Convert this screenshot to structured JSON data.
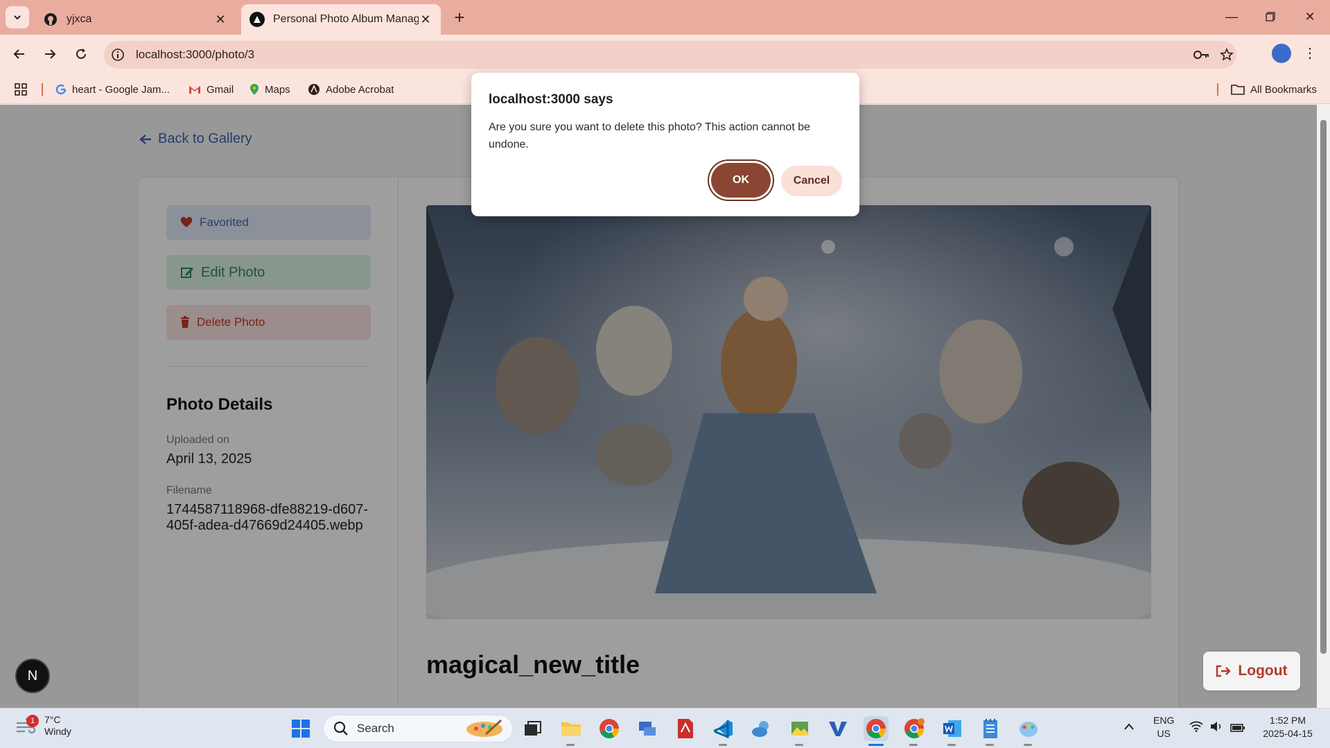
{
  "browser": {
    "tabs": [
      {
        "title": "yjxca",
        "icon": "github-icon",
        "active": false
      },
      {
        "title": "Personal Photo Album Manager",
        "icon": "nextjs-icon",
        "active": true
      }
    ],
    "url": "localhost:3000/photo/3",
    "bookmarks": [
      {
        "label": "heart - Google Jam...",
        "icon": "google-icon"
      },
      {
        "label": "Gmail",
        "icon": "gmail-icon"
      },
      {
        "label": "Maps",
        "icon": "maps-icon"
      },
      {
        "label": "Adobe Acrobat",
        "icon": "acrobat-icon"
      }
    ],
    "all_bookmarks": "All Bookmarks"
  },
  "page": {
    "back_link": "Back to Gallery",
    "actions": {
      "favorited": "Favorited",
      "edit": "Edit Photo",
      "delete": "Delete Photo"
    },
    "details": {
      "heading": "Photo Details",
      "uploaded_label": "Uploaded on",
      "uploaded_value": "April 13, 2025",
      "filename_label": "Filename",
      "filename_value": "1744587118968-dfe88219-d607-405f-adea-d47669d24405.webp"
    },
    "photo_title": "magical_new_title",
    "logout": "Logout",
    "avatar_letter": "N"
  },
  "dialog": {
    "title": "localhost:3000 says",
    "message": "Are you sure you want to delete this photo? This action cannot be undone.",
    "ok": "OK",
    "cancel": "Cancel"
  },
  "taskbar": {
    "weather_temp": "7°C",
    "weather_desc": "Windy",
    "weather_badge": "1",
    "search_placeholder": "Search",
    "lang_top": "ENG",
    "lang_bottom": "US",
    "time": "1:52 PM",
    "date": "2025-04-15"
  },
  "colors": {
    "accent": "#8a4632",
    "tabstrip": "#e9ada0",
    "toolbar": "#fbe4de"
  }
}
